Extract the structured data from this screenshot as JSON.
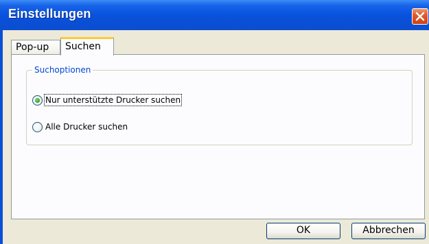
{
  "window": {
    "title": "Einstellungen"
  },
  "tabs": [
    {
      "label": "Pop-up",
      "active": false
    },
    {
      "label": "Suchen",
      "active": true
    }
  ],
  "group": {
    "legend": "Suchoptionen",
    "options": [
      {
        "label": "Nur unterstützte Drucker suchen",
        "selected": true
      },
      {
        "label": "Alle Drucker suchen",
        "selected": false
      }
    ]
  },
  "buttons": {
    "ok": "OK",
    "cancel": "Abbrechen"
  },
  "icons": {
    "close": "close-icon"
  },
  "colors": {
    "titlebar": "#0a4fd6",
    "close_button": "#e25b2d",
    "legend_text": "#0046d5",
    "active_tab_accent": "#ffc83c",
    "radio_selected": "#2ea72c"
  }
}
